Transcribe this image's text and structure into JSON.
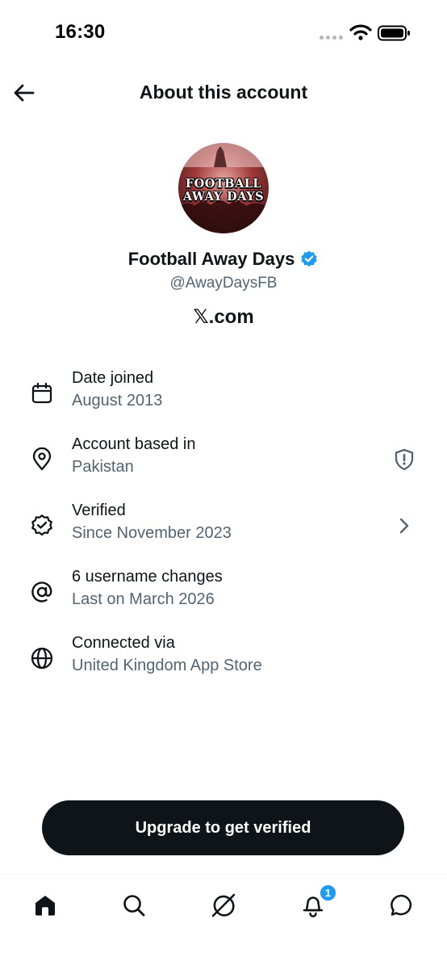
{
  "status_bar": {
    "time": "16:30"
  },
  "header": {
    "title": "About this account"
  },
  "profile": {
    "avatar_text_line1": "FOOTBALL",
    "avatar_text_line2": "AWAY DAYS",
    "name": "Football Away Days",
    "handle": "@AwayDaysFB",
    "site": "𝕏.com"
  },
  "info": [
    {
      "label": "Date joined",
      "value": "August 2013",
      "icon": "calendar-icon"
    },
    {
      "label": "Account based in",
      "value": "Pakistan",
      "icon": "location-pin-icon",
      "right_icon": "shield-alert-icon"
    },
    {
      "label": "Verified",
      "value": "Since November 2023",
      "icon": "verified-badge-icon",
      "right_icon": "chevron-right-icon"
    },
    {
      "label": "6 username changes",
      "value": "Last on March 2026",
      "icon": "at-sign-icon"
    },
    {
      "label": "Connected via",
      "value": "United Kingdom App Store",
      "icon": "globe-icon"
    }
  ],
  "actions": {
    "upgrade_label": "Upgrade to get verified"
  },
  "bottom_nav": {
    "items": [
      "home-icon",
      "search-icon",
      "grok-icon",
      "notifications-icon",
      "messages-icon"
    ],
    "notification_count": "1"
  },
  "colors": {
    "accent": "#1d9bf0",
    "text": "#0f1419",
    "secondary": "#536471",
    "button": "#0f1419"
  }
}
